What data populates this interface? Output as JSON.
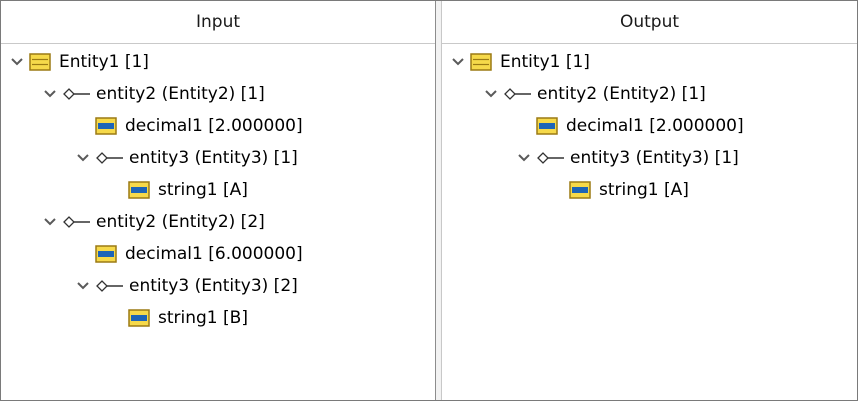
{
  "panels": {
    "input": {
      "header": "Input",
      "rows": [
        {
          "label": "Entity1 [1]",
          "icon": "entity-icon",
          "expanded": true,
          "depth": 0
        },
        {
          "label": "entity2 (Entity2) [1]",
          "icon": "connector-icon",
          "expanded": true,
          "depth": 1
        },
        {
          "label": "decimal1 [2.000000]",
          "icon": "field-icon",
          "expanded": false,
          "depth": 2
        },
        {
          "label": "entity3 (Entity3) [1]",
          "icon": "connector-icon",
          "expanded": true,
          "depth": 2
        },
        {
          "label": "string1 [A]",
          "icon": "field-icon",
          "expanded": false,
          "depth": 3
        },
        {
          "label": "entity2 (Entity2) [2]",
          "icon": "connector-icon",
          "expanded": true,
          "depth": 1
        },
        {
          "label": "decimal1 [6.000000]",
          "icon": "field-icon",
          "expanded": false,
          "depth": 2
        },
        {
          "label": "entity3 (Entity3) [2]",
          "icon": "connector-icon",
          "expanded": true,
          "depth": 2
        },
        {
          "label": "string1 [B]",
          "icon": "field-icon",
          "expanded": false,
          "depth": 3
        }
      ]
    },
    "output": {
      "header": "Output",
      "rows": [
        {
          "label": "Entity1 [1]",
          "icon": "entity-icon",
          "expanded": true,
          "depth": 0
        },
        {
          "label": "entity2 (Entity2) [1]",
          "icon": "connector-icon",
          "expanded": true,
          "depth": 1
        },
        {
          "label": "decimal1 [2.000000]",
          "icon": "field-icon",
          "expanded": false,
          "depth": 2
        },
        {
          "label": "entity3 (Entity3) [1]",
          "icon": "connector-icon",
          "expanded": true,
          "depth": 2
        },
        {
          "label": "string1 [A]",
          "icon": "field-icon",
          "expanded": false,
          "depth": 3
        }
      ]
    }
  },
  "colors": {
    "entity_fill": "#f6d94a",
    "entity_border": "#9b7a14",
    "field_fill": "#f6d94a",
    "field_blue": "#1d64b8",
    "chevron": "#5a5a5a"
  }
}
